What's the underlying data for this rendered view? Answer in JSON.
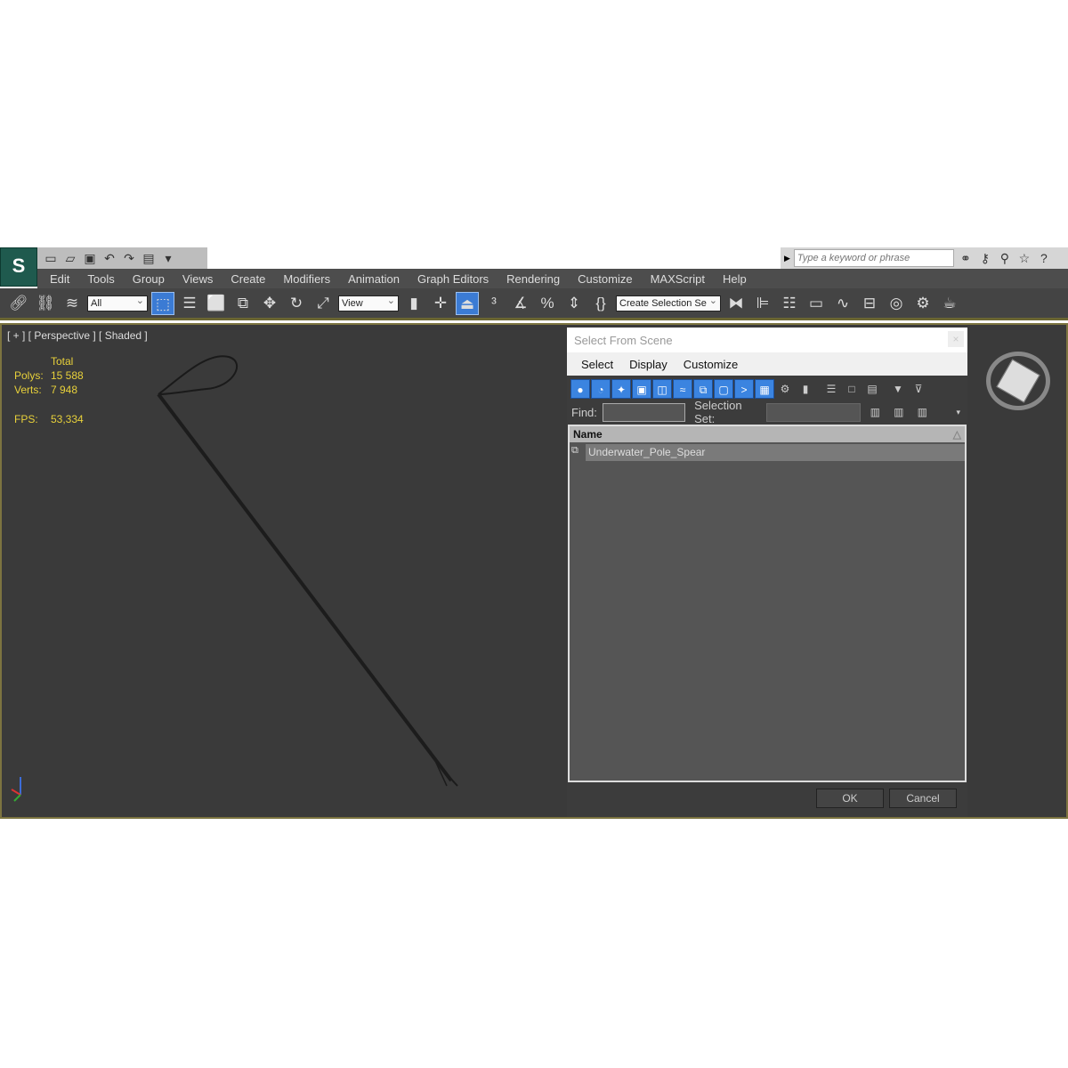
{
  "app": {
    "logo": "S"
  },
  "quick_access": {
    "icons": [
      "new-file-icon",
      "open-folder-icon",
      "save-icon",
      "undo-icon",
      "redo-icon",
      "project-icon",
      "dropdown-icon"
    ]
  },
  "search": {
    "placeholder": "Type a keyword or phrase",
    "icons": [
      "binoculars-icon",
      "key-icon",
      "satellite-icon",
      "star-icon",
      "help-icon"
    ]
  },
  "menu": [
    "Edit",
    "Tools",
    "Group",
    "Views",
    "Create",
    "Modifiers",
    "Animation",
    "Graph Editors",
    "Rendering",
    "Customize",
    "MAXScript",
    "Help"
  ],
  "toolbar": {
    "selection_filter": "All",
    "reference_coord": "View",
    "named_selection": "Create Selection Se"
  },
  "viewport": {
    "label": "[ + ] [ Perspective ] [ Shaded ]",
    "stats": {
      "header": "Total",
      "polys_label": "Polys:",
      "polys": "15 588",
      "verts_label": "Verts:",
      "verts": "7 948",
      "fps_label": "FPS:",
      "fps": "53,334"
    }
  },
  "dialog": {
    "title": "Select From Scene",
    "menu": [
      "Select",
      "Display",
      "Customize"
    ],
    "find_label": "Find:",
    "find_value": "",
    "selection_set_label": "Selection Set:",
    "selection_set_value": "",
    "column_name": "Name",
    "rows": [
      "Underwater_Pole_Spear"
    ],
    "ok": "OK",
    "cancel": "Cancel"
  },
  "colors": {
    "accent": "#3b84e0",
    "stats": "#e8d13a",
    "viewport": "#3a3a3a"
  }
}
